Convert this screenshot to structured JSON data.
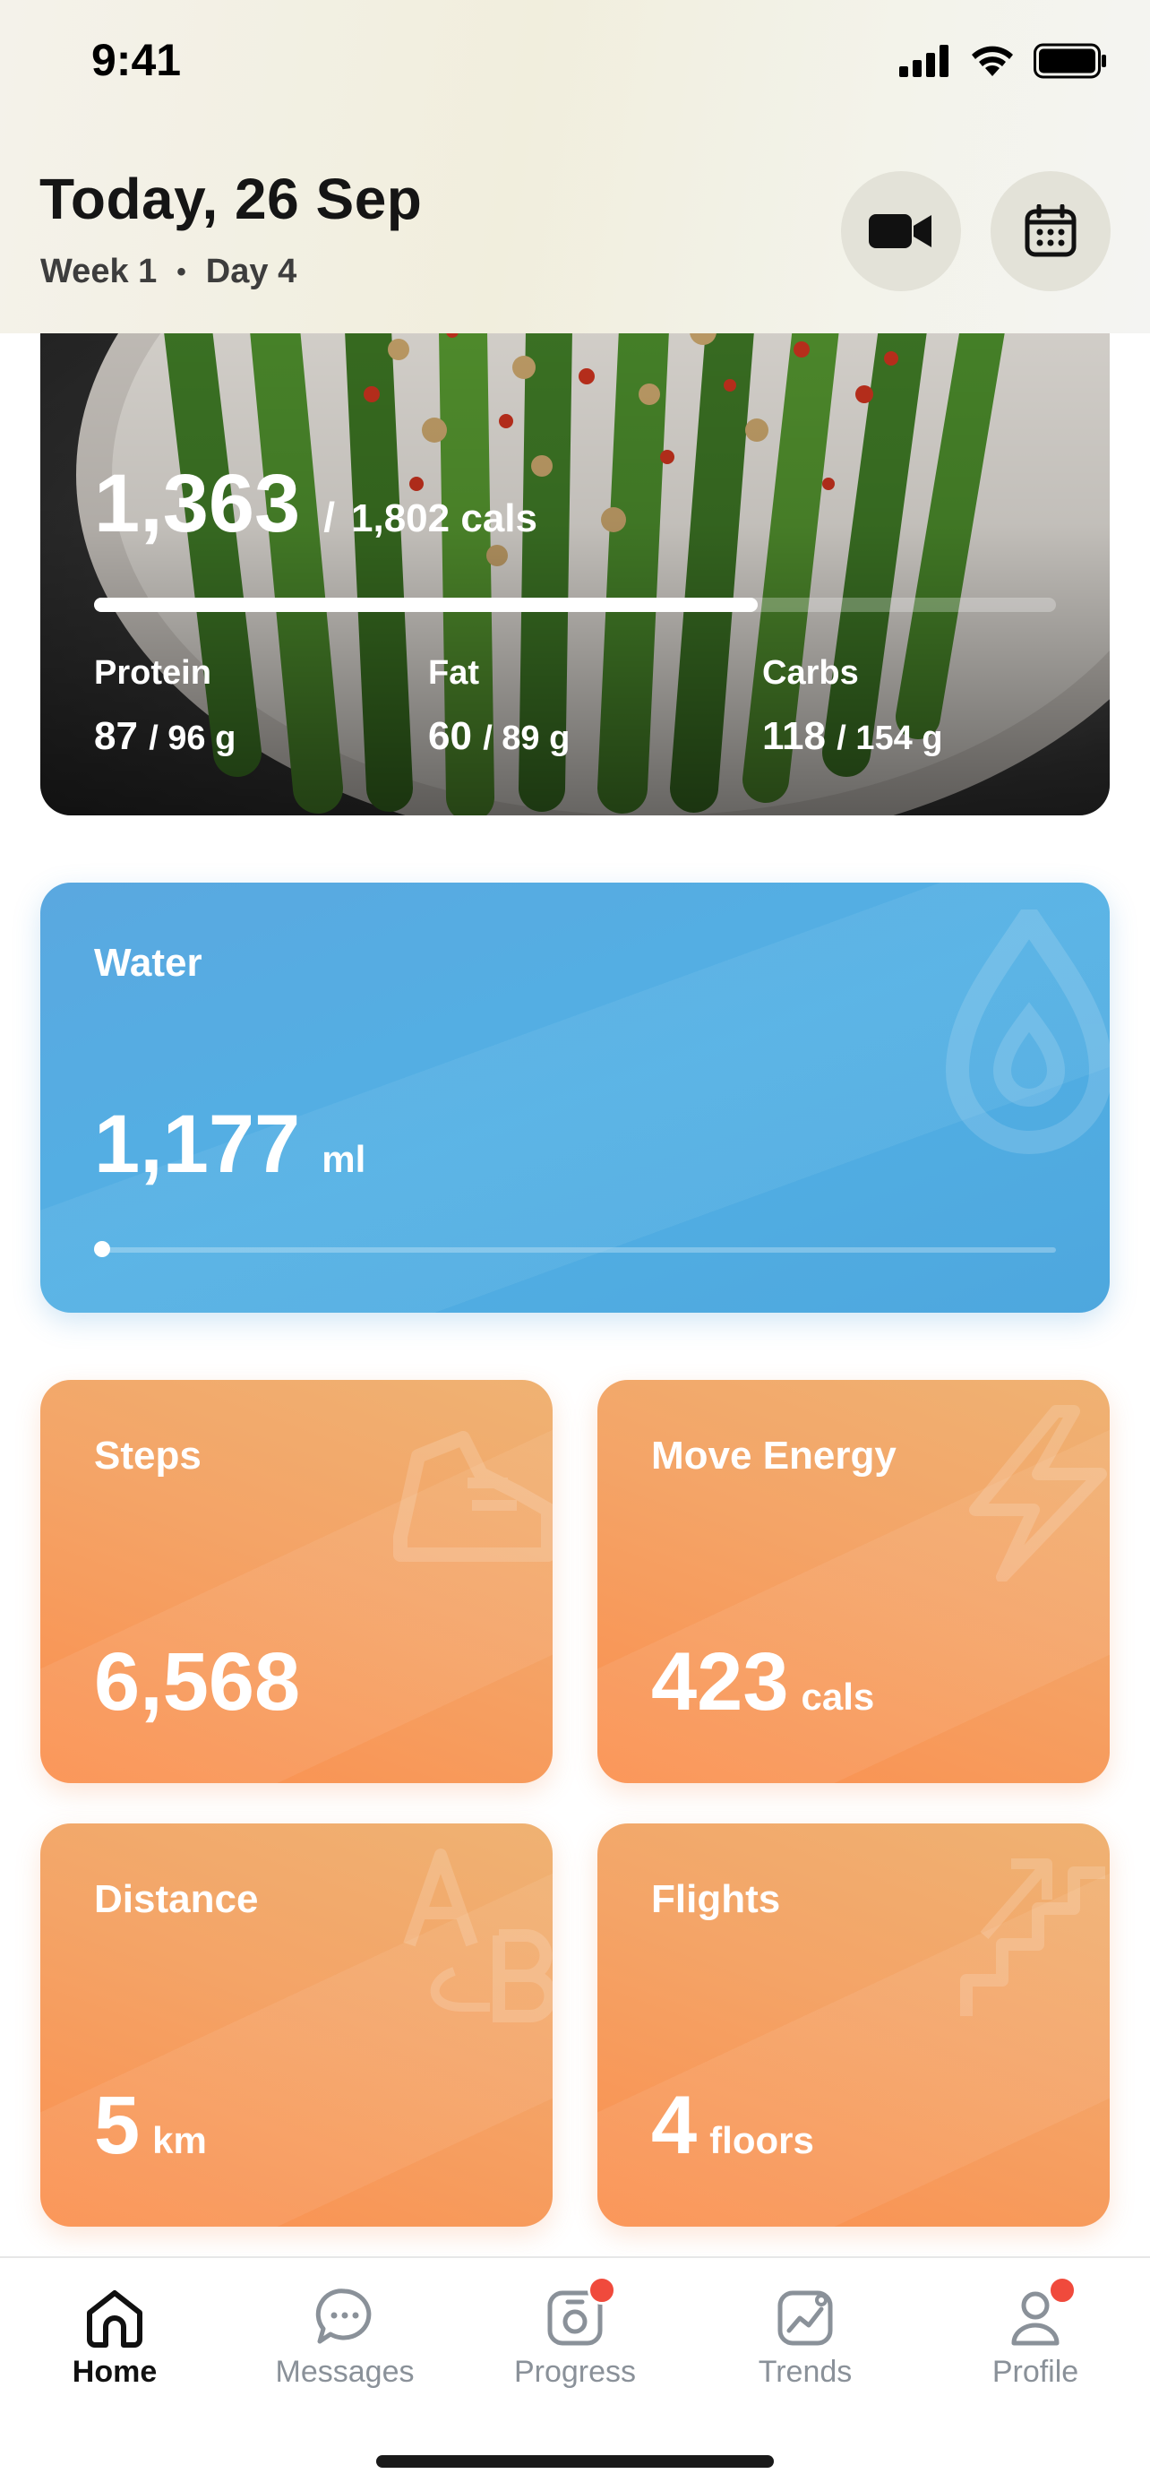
{
  "status_bar": {
    "time": "9:41"
  },
  "header": {
    "title": "Today, 26 Sep",
    "week": "Week 1",
    "separator": "•",
    "day": "Day 4",
    "video_button_icon": "video-camera-icon",
    "calendar_button_icon": "calendar-icon"
  },
  "nutrition": {
    "calories": "1,363",
    "slash": "/",
    "calories_total": "1,802 cals",
    "progress": 0.69,
    "macros": [
      {
        "label": "Protein",
        "value": "87",
        "total": "/ 96 g"
      },
      {
        "label": "Fat",
        "value": "60",
        "total": "/ 89 g"
      },
      {
        "label": "Carbs",
        "value": "118",
        "total": "/ 154 g"
      }
    ]
  },
  "water": {
    "label": "Water",
    "value": "1,177",
    "unit": "ml",
    "icon": "water-drop-icon",
    "progress": 0.0
  },
  "activity": {
    "steps": {
      "label": "Steps",
      "value": "6,568",
      "unit": "",
      "icon": "sneaker-icon"
    },
    "move_energy": {
      "label": "Move Energy",
      "value": "423",
      "unit": "cals",
      "icon": "lightning-icon"
    },
    "distance": {
      "label": "Distance",
      "value": "5",
      "unit": "km",
      "icon": "a-to-b-icon"
    },
    "flights": {
      "label": "Flights",
      "value": "4",
      "unit": "floors",
      "icon": "stairs-icon"
    }
  },
  "tabs": [
    {
      "label": "Home",
      "icon": "home-icon",
      "active": true,
      "badge": false
    },
    {
      "label": "Messages",
      "icon": "chat-bubble-icon",
      "active": false,
      "badge": false
    },
    {
      "label": "Progress",
      "icon": "camera-icon",
      "active": false,
      "badge": true
    },
    {
      "label": "Trends",
      "icon": "trend-chart-icon",
      "active": false,
      "badge": false
    },
    {
      "label": "Profile",
      "icon": "person-icon",
      "active": false,
      "badge": true
    }
  ],
  "colors": {
    "water_card": "#52b0e4",
    "activity_card": "#f4a467",
    "badge": "#f04a3c",
    "active_tab": "#111111",
    "inactive_tab": "#8a9199"
  }
}
